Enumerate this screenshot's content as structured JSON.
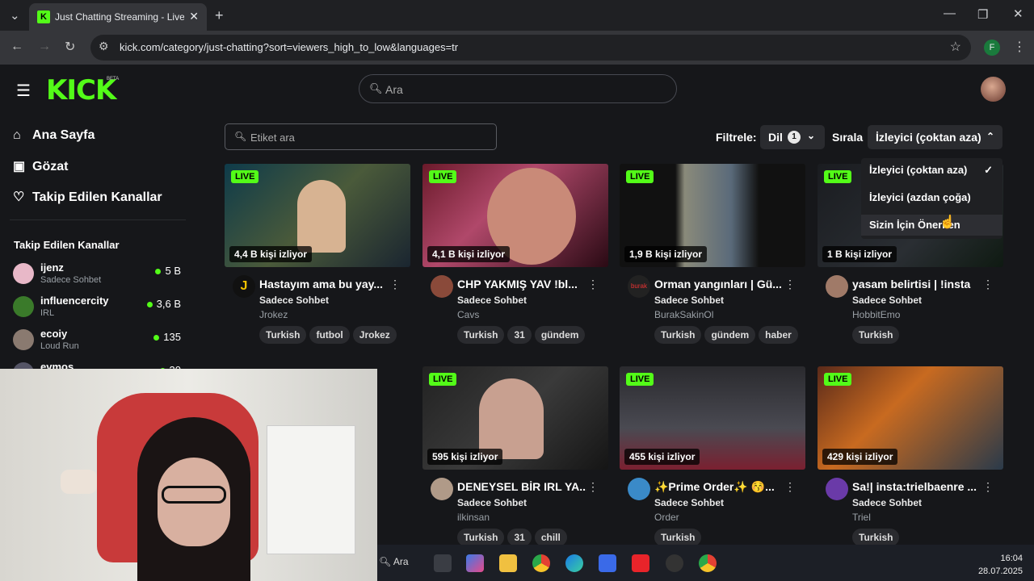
{
  "browser": {
    "tab_title": "Just Chatting Streaming - Live S",
    "tab_favicon": "K",
    "url": "kick.com/category/just-chatting?sort=viewers_high_to_low&languages=tr",
    "profile_initial": "F",
    "accent": "#53fc18"
  },
  "header": {
    "logo": "KICK",
    "beta": "BETA",
    "search_placeholder": "Ara"
  },
  "sidebar": {
    "nav": [
      {
        "label": "Ana Sayfa",
        "icon": "home-icon"
      },
      {
        "label": "Gözat",
        "icon": "browse-icon"
      },
      {
        "label": "Takip Edilen Kanallar",
        "icon": "heart-icon"
      }
    ],
    "followed_header": "Takip Edilen Kanallar",
    "channels": [
      {
        "name": "ijenz",
        "category": "Sadece Sohbet",
        "viewers": "5 B"
      },
      {
        "name": "influencercity",
        "category": "IRL",
        "viewers": "3,6 B"
      },
      {
        "name": "ecoiy",
        "category": "Loud Run",
        "viewers": "135"
      },
      {
        "name": "evmos",
        "category": "",
        "viewers": "30"
      }
    ]
  },
  "filters": {
    "tag_search_placeholder": "Etiket ara",
    "filter_label": "Filtrele:",
    "lang_label": "Dil",
    "lang_count": "1",
    "sort_label": "Sırala",
    "sort_value": "İzleyici (çoktan aza)",
    "sort_options": [
      "İzleyici (çoktan aza)",
      "İzleyici (azdan çoğa)",
      "Sizin İçin Önerilen"
    ]
  },
  "cards": [
    {
      "title": "Hastayım ama bu yay...",
      "category": "Sadece Sohbet",
      "streamer": "Jrokez",
      "viewers": "4,4 B kişi izliyor",
      "tags": [
        "Turkish",
        "futbol",
        "Jrokez"
      ],
      "live": "LIVE"
    },
    {
      "title": "CHP YAKMIŞ YAV !bl...",
      "category": "Sadece Sohbet",
      "streamer": "Cavs",
      "viewers": "4,1 B kişi izliyor",
      "tags": [
        "Turkish",
        "31",
        "gündem"
      ],
      "live": "LIVE"
    },
    {
      "title": "Orman yangınları | Gü...",
      "category": "Sadece Sohbet",
      "streamer": "BurakSakinOl",
      "viewers": "1,9 B kişi izliyor",
      "tags": [
        "Turkish",
        "gündem",
        "haber"
      ],
      "live": "LIVE"
    },
    {
      "title": "yasam belirtisi | !insta",
      "category": "Sadece Sohbet",
      "streamer": "HobbitEmo",
      "viewers": "1 B kişi izliyor",
      "tags": [
        "Turkish"
      ],
      "live": "LIVE"
    },
    {
      "title": "DENEYSEL BİR IRL YA...",
      "category": "Sadece Sohbet",
      "streamer": "ilkinsan",
      "viewers": "595 kişi izliyor",
      "tags": [
        "Turkish",
        "31",
        "chill"
      ],
      "live": "LIVE"
    },
    {
      "title": "✨Prime Order✨ 😚...",
      "category": "Sadece Sohbet",
      "streamer": "Order",
      "viewers": "455 kişi izliyor",
      "tags": [
        "Turkish"
      ],
      "live": "LIVE"
    },
    {
      "title": "Sa!| insta:trielbaenre ...",
      "category": "Sadece Sohbet",
      "streamer": "Triel",
      "viewers": "429 kişi izliyor",
      "tags": [
        "Turkish"
      ],
      "live": "LIVE"
    }
  ],
  "taskbar": {
    "search_label": "Ara",
    "time": "16:04",
    "date": "28.07.2025"
  }
}
